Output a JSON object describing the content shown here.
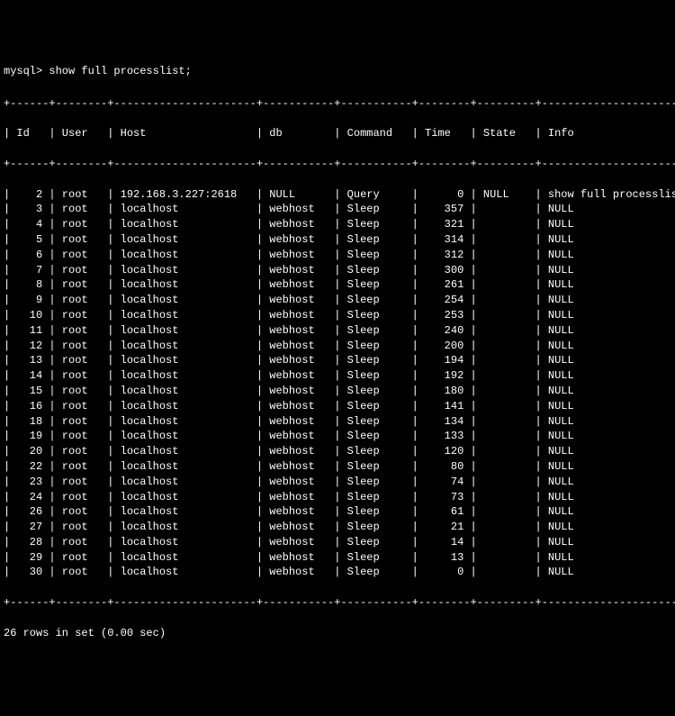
{
  "prompt": "mysql> show full processlist;",
  "columns": [
    "Id",
    "User",
    "Host",
    "db",
    "Command",
    "Time",
    "State",
    "Info"
  ],
  "widths": [
    4,
    6,
    20,
    9,
    9,
    6,
    7,
    23
  ],
  "aligns": [
    "r",
    "l",
    "l",
    "l",
    "l",
    "r",
    "l",
    "l"
  ],
  "rows": [
    {
      "id": "2",
      "user": "root",
      "host": "192.168.3.227:2618",
      "db": "NULL",
      "command": "Query",
      "time": "0",
      "state": "NULL",
      "info": "show full processlist"
    },
    {
      "id": "3",
      "user": "root",
      "host": "localhost",
      "db": "webhost",
      "command": "Sleep",
      "time": "357",
      "state": "",
      "info": "NULL"
    },
    {
      "id": "4",
      "user": "root",
      "host": "localhost",
      "db": "webhost",
      "command": "Sleep",
      "time": "321",
      "state": "",
      "info": "NULL"
    },
    {
      "id": "5",
      "user": "root",
      "host": "localhost",
      "db": "webhost",
      "command": "Sleep",
      "time": "314",
      "state": "",
      "info": "NULL"
    },
    {
      "id": "6",
      "user": "root",
      "host": "localhost",
      "db": "webhost",
      "command": "Sleep",
      "time": "312",
      "state": "",
      "info": "NULL"
    },
    {
      "id": "7",
      "user": "root",
      "host": "localhost",
      "db": "webhost",
      "command": "Sleep",
      "time": "300",
      "state": "",
      "info": "NULL"
    },
    {
      "id": "8",
      "user": "root",
      "host": "localhost",
      "db": "webhost",
      "command": "Sleep",
      "time": "261",
      "state": "",
      "info": "NULL"
    },
    {
      "id": "9",
      "user": "root",
      "host": "localhost",
      "db": "webhost",
      "command": "Sleep",
      "time": "254",
      "state": "",
      "info": "NULL"
    },
    {
      "id": "10",
      "user": "root",
      "host": "localhost",
      "db": "webhost",
      "command": "Sleep",
      "time": "253",
      "state": "",
      "info": "NULL"
    },
    {
      "id": "11",
      "user": "root",
      "host": "localhost",
      "db": "webhost",
      "command": "Sleep",
      "time": "240",
      "state": "",
      "info": "NULL"
    },
    {
      "id": "12",
      "user": "root",
      "host": "localhost",
      "db": "webhost",
      "command": "Sleep",
      "time": "200",
      "state": "",
      "info": "NULL"
    },
    {
      "id": "13",
      "user": "root",
      "host": "localhost",
      "db": "webhost",
      "command": "Sleep",
      "time": "194",
      "state": "",
      "info": "NULL"
    },
    {
      "id": "14",
      "user": "root",
      "host": "localhost",
      "db": "webhost",
      "command": "Sleep",
      "time": "192",
      "state": "",
      "info": "NULL"
    },
    {
      "id": "15",
      "user": "root",
      "host": "localhost",
      "db": "webhost",
      "command": "Sleep",
      "time": "180",
      "state": "",
      "info": "NULL"
    },
    {
      "id": "16",
      "user": "root",
      "host": "localhost",
      "db": "webhost",
      "command": "Sleep",
      "time": "141",
      "state": "",
      "info": "NULL"
    },
    {
      "id": "18",
      "user": "root",
      "host": "localhost",
      "db": "webhost",
      "command": "Sleep",
      "time": "134",
      "state": "",
      "info": "NULL"
    },
    {
      "id": "19",
      "user": "root",
      "host": "localhost",
      "db": "webhost",
      "command": "Sleep",
      "time": "133",
      "state": "",
      "info": "NULL"
    },
    {
      "id": "20",
      "user": "root",
      "host": "localhost",
      "db": "webhost",
      "command": "Sleep",
      "time": "120",
      "state": "",
      "info": "NULL"
    },
    {
      "id": "22",
      "user": "root",
      "host": "localhost",
      "db": "webhost",
      "command": "Sleep",
      "time": "80",
      "state": "",
      "info": "NULL"
    },
    {
      "id": "23",
      "user": "root",
      "host": "localhost",
      "db": "webhost",
      "command": "Sleep",
      "time": "74",
      "state": "",
      "info": "NULL"
    },
    {
      "id": "24",
      "user": "root",
      "host": "localhost",
      "db": "webhost",
      "command": "Sleep",
      "time": "73",
      "state": "",
      "info": "NULL"
    },
    {
      "id": "26",
      "user": "root",
      "host": "localhost",
      "db": "webhost",
      "command": "Sleep",
      "time": "61",
      "state": "",
      "info": "NULL"
    },
    {
      "id": "27",
      "user": "root",
      "host": "localhost",
      "db": "webhost",
      "command": "Sleep",
      "time": "21",
      "state": "",
      "info": "NULL"
    },
    {
      "id": "28",
      "user": "root",
      "host": "localhost",
      "db": "webhost",
      "command": "Sleep",
      "time": "14",
      "state": "",
      "info": "NULL"
    },
    {
      "id": "29",
      "user": "root",
      "host": "localhost",
      "db": "webhost",
      "command": "Sleep",
      "time": "13",
      "state": "",
      "info": "NULL"
    },
    {
      "id": "30",
      "user": "root",
      "host": "localhost",
      "db": "webhost",
      "command": "Sleep",
      "time": "0",
      "state": "",
      "info": "NULL"
    }
  ],
  "footer": "26 rows in set (0.00 sec)"
}
